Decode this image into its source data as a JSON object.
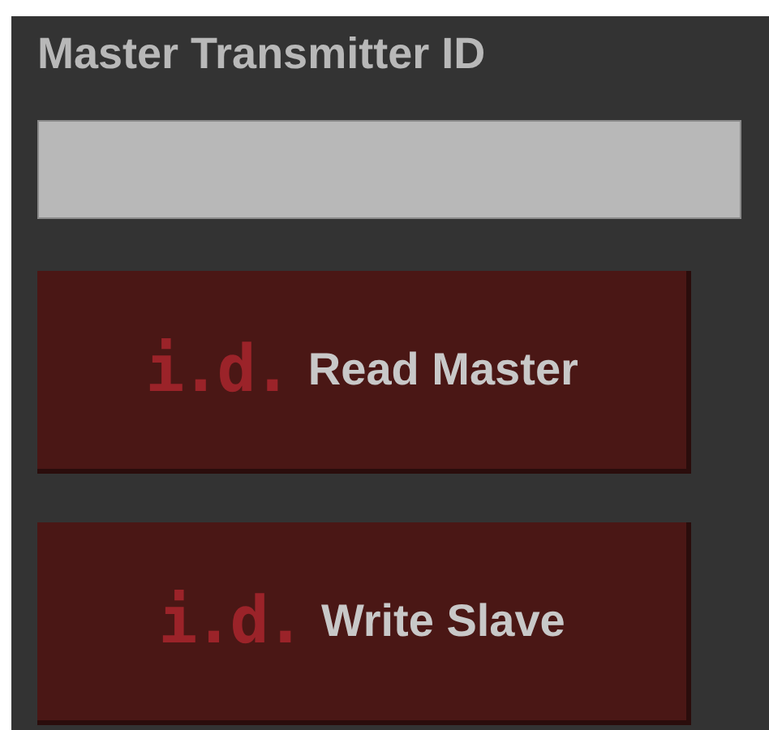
{
  "title": "Master Transmitter ID",
  "buttons": [
    {
      "logo": "i.d.",
      "label": "Read Master"
    },
    {
      "logo": "i.d.",
      "label": "Write Slave"
    }
  ]
}
